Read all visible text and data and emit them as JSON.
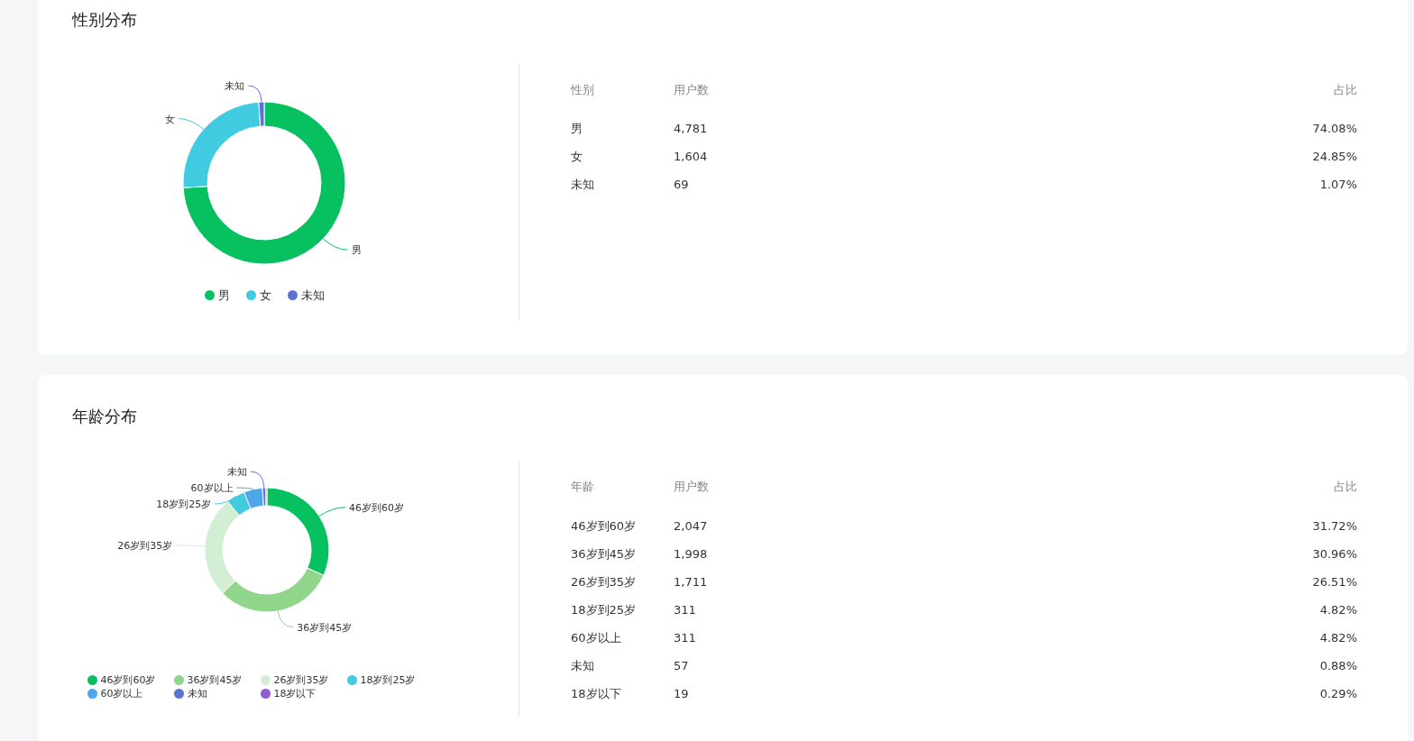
{
  "sections": [
    {
      "title": "性别分布",
      "chart_data": {
        "type": "donut",
        "categories": [
          "男",
          "女",
          "未知"
        ],
        "values": [
          74.08,
          24.85,
          1.07
        ],
        "annotations": [
          "男",
          "女",
          "未知"
        ]
      },
      "legend": [
        {
          "color": "#07c160"
        },
        {
          "color": "#40cbe0"
        },
        {
          "color": "#5d72d3"
        }
      ],
      "table": {
        "columns": [
          "性别",
          "用户数",
          "占比"
        ],
        "rows": [
          [
            "男",
            "4,781",
            "74.08%"
          ],
          [
            "女",
            "1,604",
            "24.85%"
          ],
          [
            "未知",
            "69",
            "1.07%"
          ]
        ]
      }
    },
    {
      "title": "年龄分布",
      "chart_data": {
        "type": "donut",
        "categories": [
          "46岁到60岁",
          "36岁到45岁",
          "26岁到35岁",
          "18岁到25岁",
          "60岁以上",
          "未知",
          "18岁以下"
        ],
        "values": [
          31.72,
          30.96,
          26.51,
          4.82,
          4.82,
          0.88,
          0.29
        ],
        "annotations": [
          "46岁到60岁",
          "36岁到45岁",
          "26岁到35岁",
          "18岁到25岁",
          "60岁以上",
          "未知",
          null
        ]
      },
      "legend": [
        {
          "color": "#07c160"
        },
        {
          "color": "#8fd68b"
        },
        {
          "color": "#d2efd3"
        },
        {
          "color": "#40cbe0"
        },
        {
          "color": "#4ea5ea"
        },
        {
          "color": "#5d72d3"
        },
        {
          "color": "#8e5bd0"
        }
      ],
      "table": {
        "columns": [
          "年龄",
          "用户数",
          "占比"
        ],
        "rows": [
          [
            "46岁到60岁",
            "2,047",
            "31.72%"
          ],
          [
            "36岁到45岁",
            "1,998",
            "30.96%"
          ],
          [
            "26岁到35岁",
            "1,711",
            "26.51%"
          ],
          [
            "18岁到25岁",
            "311",
            "4.82%"
          ],
          [
            "60岁以上",
            "311",
            "4.82%"
          ],
          [
            "未知",
            "57",
            "0.88%"
          ],
          [
            "18岁以下",
            "19",
            "0.29%"
          ]
        ]
      }
    }
  ]
}
